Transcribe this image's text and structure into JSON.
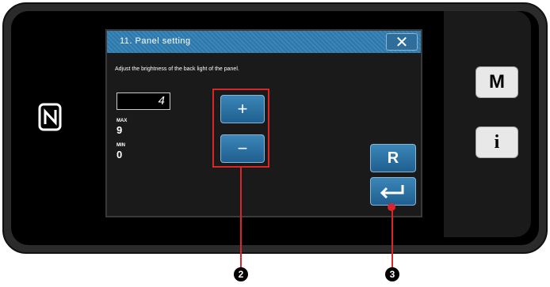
{
  "dialog": {
    "title": "11.  Panel setting",
    "close_symbol": "✕",
    "description": "Adjust the brightness of the back light of the panel."
  },
  "value": {
    "current": "4",
    "max_label": "MAX",
    "max_value": "9",
    "min_label": "MIN",
    "min_value": "0"
  },
  "buttons": {
    "plus": "+",
    "minus": "−",
    "reset": "R",
    "enter_icon": "enter-icon"
  },
  "side_buttons": {
    "mode": "M",
    "info": "i"
  },
  "callouts": {
    "pm_buttons": "2",
    "enter_button": "3"
  },
  "colors": {
    "accent": "#2e77a8",
    "highlight": "#d9262b"
  }
}
